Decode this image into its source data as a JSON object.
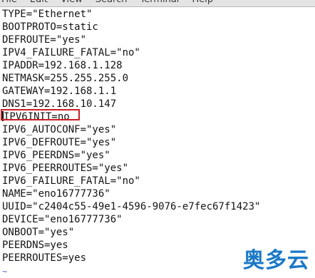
{
  "menu": {
    "items": [
      "File",
      "Edit",
      "View",
      "Search",
      "Terminal",
      "Help"
    ]
  },
  "editor": {
    "lines": [
      "TYPE=\"Ethernet\"",
      "BOOTPROTO=static",
      "DEFROUTE=\"yes\"",
      "IPV4_FAILURE_FATAL=\"no\"",
      "IPADDR=192.168.1.128",
      "NETMASK=255.255.255.0",
      "GATEWAY=192.168.1.1",
      "DNS1=192.168.10.147",
      "IPV6INIT=no",
      "IPV6_AUTOCONF=\"yes\"",
      "IPV6_DEFROUTE=\"yes\"",
      "IPV6_PEERDNS=\"yes\"",
      "IPV6_PEERROUTES=\"yes\"",
      "IPV6_FAILURE_FATAL=\"no\"",
      "NAME=\"eno16777736\"",
      "UUID=\"c2404c55-49e1-4596-9076-e7fec67f1423\"",
      "DEVICE=\"eno16777736\"",
      "ONBOOT=\"yes\"",
      "PEERDNS=yes",
      "PEERROUTES=yes"
    ],
    "cursor_line_index": 8,
    "empty_line_marker": "~"
  },
  "watermark": {
    "text": "奥多云",
    "color": "#1a78c8"
  },
  "colors": {
    "highlight_border": "#cc1f27",
    "text": "#141414",
    "tilde": "#4a6ad0"
  }
}
